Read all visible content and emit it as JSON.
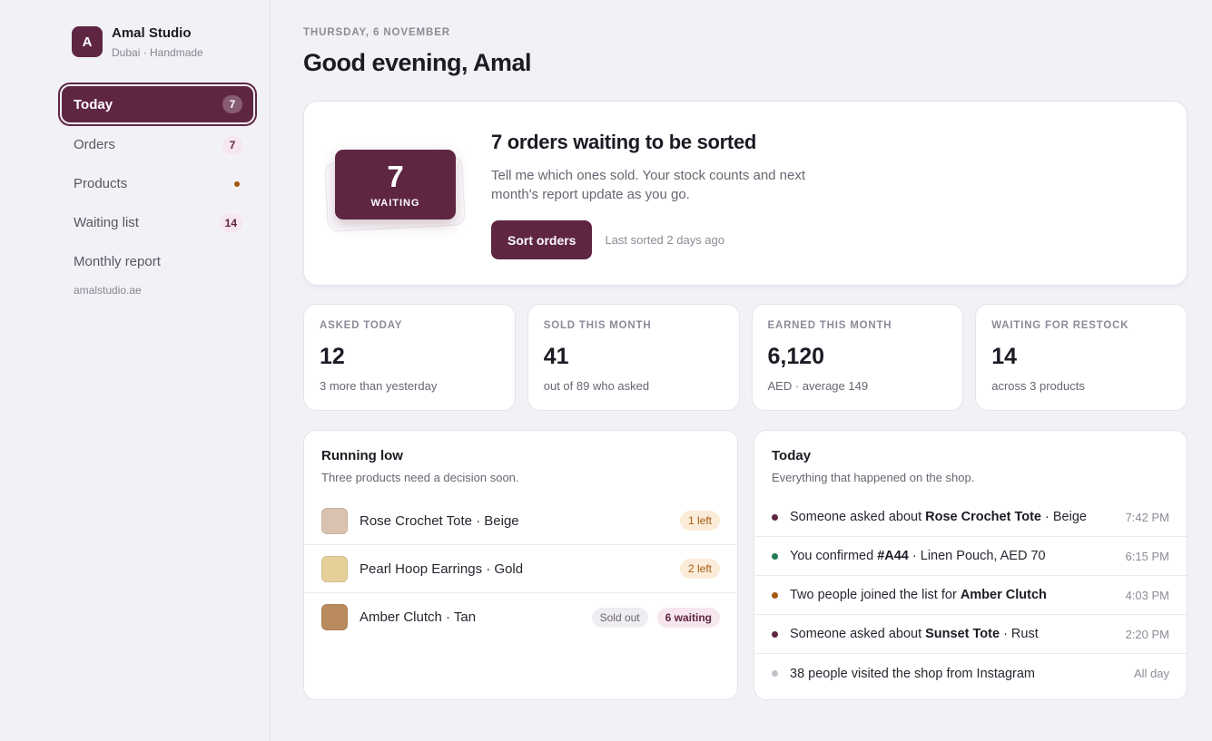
{
  "sidebar": {
    "brand": {
      "initial": "A",
      "name": "Amal Studio",
      "sub": "Dubai · Handmade"
    },
    "nav": [
      {
        "label": "Today",
        "badge": "7",
        "active": true
      },
      {
        "label": "Orders",
        "badge": "7"
      },
      {
        "label": "Products",
        "dot": true
      },
      {
        "label": "Waiting list",
        "badge": "14"
      },
      {
        "label": "Monthly report"
      }
    ],
    "site": "amalstudio.ae"
  },
  "header": {
    "date": "THURSDAY, 6 NOVEMBER",
    "greeting": "Good evening, Amal"
  },
  "hero": {
    "count": "7",
    "count_label": "WAITING",
    "title": "7 orders waiting to be sorted",
    "desc": "Tell me which ones sold. Your stock counts and next month's report update as you go.",
    "button": "Sort orders",
    "last_sorted": "Last sorted 2 days ago"
  },
  "stats": [
    {
      "label": "ASKED TODAY",
      "value": "12",
      "note": "3 more than yesterday"
    },
    {
      "label": "SOLD THIS MONTH",
      "value": "41",
      "note": "out of 89 who asked"
    },
    {
      "label": "EARNED THIS MONTH",
      "value": "6,120",
      "note": "AED · average 149"
    },
    {
      "label": "WAITING FOR RESTOCK",
      "value": "14",
      "note": "across 3 products"
    }
  ],
  "running_low": {
    "title": "Running low",
    "sub": "Three products need a decision soon.",
    "items": [
      {
        "name": "Rose Crochet Tote · Beige",
        "swatch": "#d9c3b0",
        "left": "1 left"
      },
      {
        "name": "Pearl Hoop Earrings · Gold",
        "swatch": "#e6d09a",
        "left": "2 left"
      },
      {
        "name": "Amber Clutch · Tan",
        "swatch": "#b98a5e",
        "out": "Sold out",
        "waiting": "6 waiting"
      }
    ]
  },
  "today": {
    "title": "Today",
    "sub": "Everything that happened on the shop.",
    "items": [
      {
        "dot": "#5f2644",
        "pre": "Someone asked about ",
        "bold": "Rose Crochet Tote",
        "post": " · Beige",
        "time": "7:42 PM"
      },
      {
        "dot": "#1f7a52",
        "pre": "You confirmed ",
        "bold": "#A44",
        "post": " · Linen Pouch, AED 70",
        "time": "6:15 PM"
      },
      {
        "dot": "#a4580f",
        "pre": "Two people joined the list for ",
        "bold": "Amber Clutch",
        "post": "",
        "time": "4:03 PM"
      },
      {
        "dot": "#5f2644",
        "pre": "Someone asked about ",
        "bold": "Sunset Tote",
        "post": " · Rust",
        "time": "2:20 PM"
      },
      {
        "dot": "#c4c0ca",
        "pre": "38 people visited the shop from Instagram",
        "bold": "",
        "post": "",
        "time": "All day"
      }
    ]
  },
  "colors": {
    "accent": "#5f2644",
    "amber": "#a4580f",
    "green": "#1f7a52"
  }
}
